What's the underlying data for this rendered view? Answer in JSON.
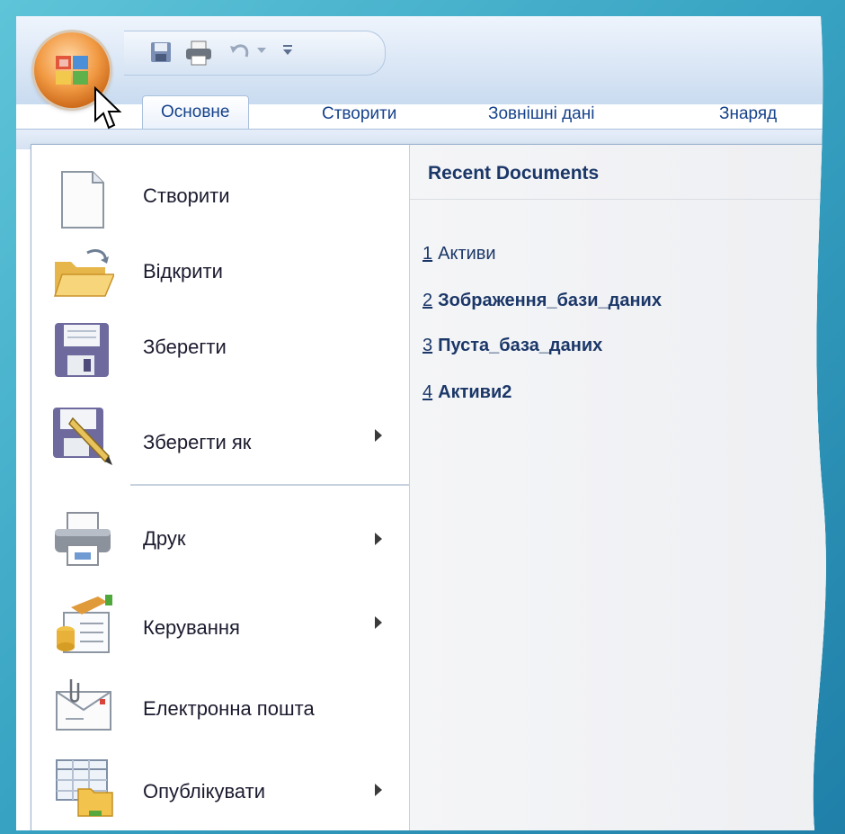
{
  "tabs": [
    "Основне",
    "Створити",
    "Зовнішні дані",
    "Знаряд"
  ],
  "menu": {
    "items": [
      {
        "label": "Створити",
        "submenu": false,
        "icon": "new-document-icon"
      },
      {
        "label": "Відкрити",
        "submenu": false,
        "icon": "open-folder-icon"
      },
      {
        "label": "Зберегти",
        "submenu": false,
        "icon": "save-icon"
      },
      {
        "label": "Зберегти як",
        "submenu": true,
        "icon": "save-as-icon"
      },
      {
        "label": "Друк",
        "submenu": true,
        "icon": "print-icon"
      },
      {
        "label": "Керування",
        "submenu": true,
        "icon": "manage-icon"
      },
      {
        "label": "Електронна пошта",
        "submenu": false,
        "icon": "email-icon"
      },
      {
        "label": "Опублікувати",
        "submenu": true,
        "icon": "publish-icon"
      }
    ]
  },
  "recent": {
    "title": "Recent Documents",
    "items": [
      {
        "num": "1",
        "name": "Активи"
      },
      {
        "num": "2",
        "name": "Зображення_бази_даних"
      },
      {
        "num": "3",
        "name": "Пуста_база_даних"
      },
      {
        "num": "4",
        "name": "Активи2"
      }
    ]
  },
  "colors": {
    "accent": "#15428b",
    "orb": "#f29b45",
    "ribbon": "#dbe7f6"
  }
}
